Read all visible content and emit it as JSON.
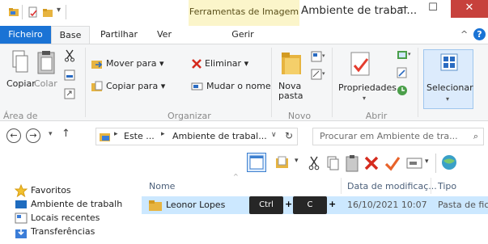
{
  "window": {
    "title": "Ambiente de trabal...",
    "contextual_tab": "Ferramentas de Imagem",
    "minimize": "—",
    "maximize": "☐",
    "close": "✕"
  },
  "tabs": [
    "Ficheiro",
    "Base",
    "Partilhar",
    "Ver",
    "Gerir"
  ],
  "ribbon": {
    "clipboard": {
      "copy": "Copiar",
      "paste": "Colar",
      "label": "Área de Transferência"
    },
    "organize": {
      "move_to": "Mover para ▾",
      "copy_to": "Copiar para ▾",
      "delete": "Eliminar ▾",
      "rename": "Mudar o nome",
      "label": "Organizar"
    },
    "new": {
      "new_folder_line1": "Nova",
      "new_folder_line2": "pasta",
      "label": "Novo"
    },
    "open": {
      "properties": "Propriedades",
      "label": "Abrir"
    },
    "select": {
      "select": "Selecionar"
    }
  },
  "address": {
    "path_part1": "Este ...",
    "path_part2": "Ambiente de trabal...",
    "search_placeholder": "Procurar em Ambiente de tra..."
  },
  "navigation": {
    "items": [
      "Favoritos",
      "Ambiente de trabalh",
      "Locais recentes",
      "Transferências"
    ]
  },
  "file_list": {
    "columns": [
      "Nome",
      "Data de modificaç...",
      "Tipo"
    ],
    "rows": [
      {
        "name": "Leonor Lopes",
        "date": "16/10/2021 10:07",
        "type": "Pasta de fich"
      }
    ]
  },
  "keyboard_overlay": {
    "key1": "Ctrl",
    "plus1": "+",
    "key2": "C",
    "plus2": "+"
  },
  "colors": {
    "accent": "#1a73d5",
    "selection": "#cce8ff",
    "close": "#c7413c",
    "contextual": "#fbf5ca",
    "folder": "#e7b440"
  }
}
